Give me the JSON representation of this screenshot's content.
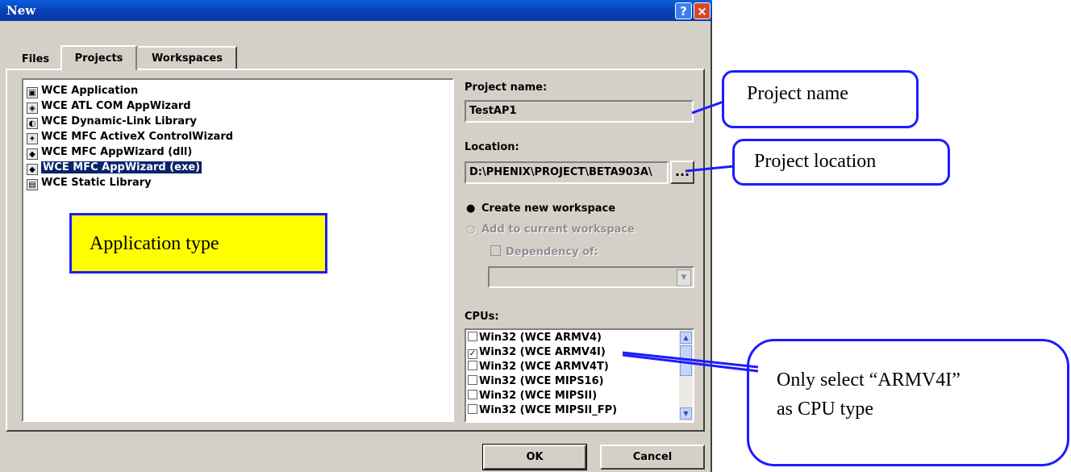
{
  "window": {
    "title": "New",
    "help_glyph": "?",
    "close_glyph": "×"
  },
  "tabs": [
    "Files",
    "Projects",
    "Workspaces"
  ],
  "project_types": [
    {
      "label": "WCE Application",
      "icon": "app-icon",
      "selected": false
    },
    {
      "label": "WCE ATL COM AppWizard",
      "icon": "atl-icon",
      "selected": false
    },
    {
      "label": "WCE Dynamic-Link Library",
      "icon": "dll-icon",
      "selected": false
    },
    {
      "label": "WCE MFC ActiveX ControlWizard",
      "icon": "activex-icon",
      "selected": false
    },
    {
      "label": "WCE MFC AppWizard (dll)",
      "icon": "mfc-dll-icon",
      "selected": false
    },
    {
      "label": "WCE MFC AppWizard (exe)",
      "icon": "mfc-exe-icon",
      "selected": true
    },
    {
      "label": "WCE Static Library",
      "icon": "lib-icon",
      "selected": false
    }
  ],
  "project_name": {
    "label": "Project name:",
    "value": "TestAP1"
  },
  "location": {
    "label": "Location:",
    "value": "D:\\PHENIX\\PROJECT\\BETA903A\\",
    "browse_label": "..."
  },
  "workspace_options": {
    "create_new": "Create new workspace",
    "add_current": "Add to current workspace",
    "dependency": "Dependency of:"
  },
  "cpus": {
    "label": "CPUs:",
    "items": [
      {
        "label": "Win32 (WCE ARMV4)",
        "checked": false
      },
      {
        "label": "Win32 (WCE ARMV4I)",
        "checked": true
      },
      {
        "label": "Win32 (WCE ARMV4T)",
        "checked": false
      },
      {
        "label": "Win32 (WCE MIPS16)",
        "checked": false
      },
      {
        "label": "Win32 (WCE MIPSII)",
        "checked": false
      },
      {
        "label": "Win32 (WCE MIPSII_FP)",
        "checked": false
      }
    ]
  },
  "buttons": {
    "ok": "OK",
    "cancel": "Cancel"
  },
  "annotations": {
    "project_name": "Project name",
    "project_location": "Project location",
    "application_type": "Application type",
    "cpu_line1": "Only select “ARMV4I”",
    "cpu_line2": "as CPU type"
  },
  "colors": {
    "callout_border": "#1c1cff",
    "highlight": "#ffff00",
    "selection": "#0a246a"
  }
}
